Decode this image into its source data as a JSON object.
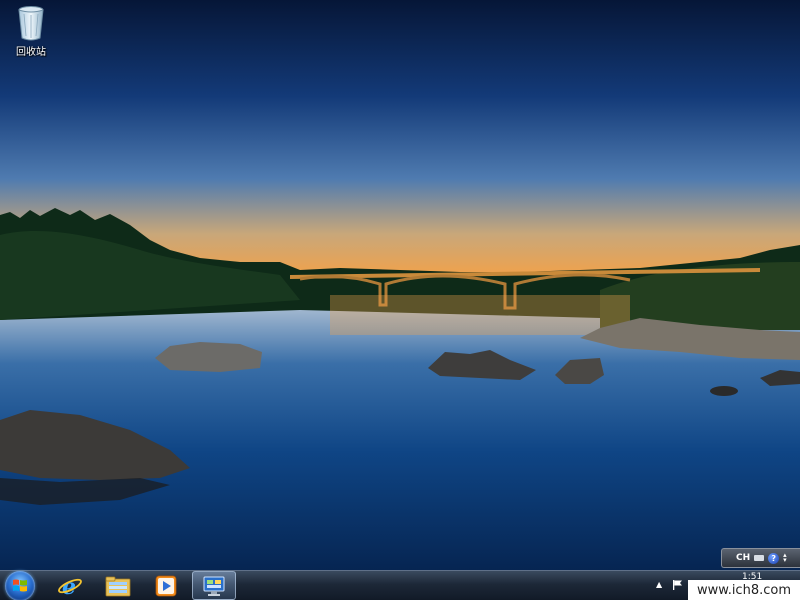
{
  "desktop": {
    "icons": [
      {
        "label": "回收站",
        "icon": "recycle-bin-icon"
      }
    ]
  },
  "language_bar": {
    "language": "CH",
    "keyboard_icon": "keyboard-icon",
    "help_label": "?",
    "options_icon": "options-arrows-icon"
  },
  "taskbar": {
    "start_icon": "windows-logo-icon",
    "pinned": [
      {
        "name": "internet-explorer",
        "icon": "internet-explorer-icon"
      },
      {
        "name": "windows-explorer",
        "icon": "folder-library-icon"
      },
      {
        "name": "media-player",
        "icon": "media-player-icon"
      },
      {
        "name": "control-panel",
        "icon": "control-panel-icon",
        "active": true
      }
    ],
    "tray": {
      "show_hidden_label": "▲",
      "flag_icon": "action-center-flag-icon",
      "clock_time": "1:51"
    }
  },
  "watermark": "www.ich8.com",
  "colors": {
    "sky_top": "#0a1e4a",
    "sky_horizon": "#f2a24a",
    "water": "#0b3d78",
    "taskbar": "#1d2838"
  }
}
